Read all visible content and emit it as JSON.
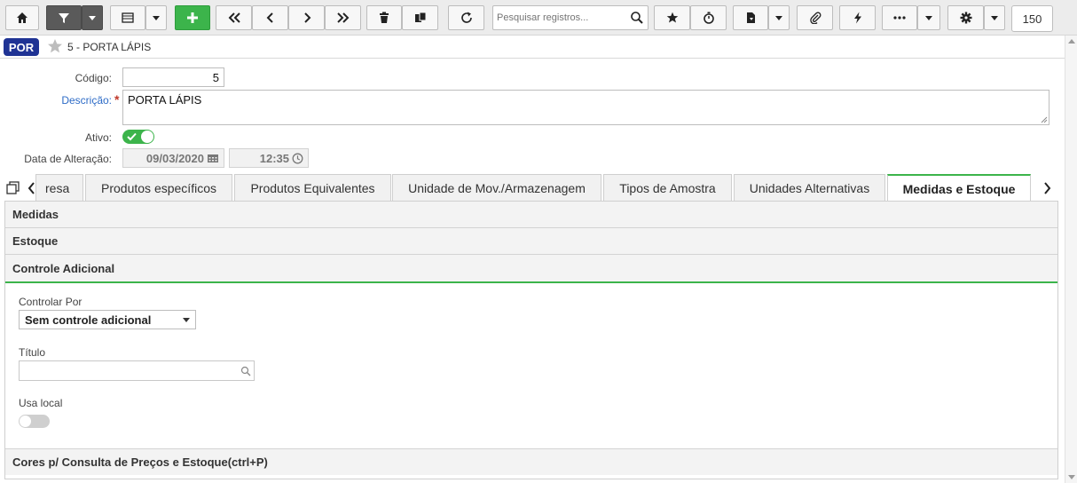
{
  "toolbar": {
    "search_placeholder": "Pesquisar registros...",
    "record_count": "150",
    "icons": [
      "home-icon",
      "filter-icon",
      "list-icon",
      "add-icon",
      "first-icon",
      "prev-icon",
      "next-icon",
      "last-icon",
      "trash-icon",
      "copy-icon",
      "refresh-icon",
      "search-icon",
      "star-icon",
      "timer-icon",
      "report-icon",
      "attach-icon",
      "bolt-icon",
      "more-icon",
      "gear-icon"
    ],
    "accent_color": "#3cb44b"
  },
  "record": {
    "badge": "POR",
    "title": "5 - PORTA LÁPIS"
  },
  "form": {
    "codigo_label": "Código:",
    "codigo_value": "5",
    "descricao_label": "Descrição:",
    "descricao_required": "*",
    "descricao_value": "PORTA LÁPIS",
    "ativo_label": "Ativo:",
    "ativo_value": true,
    "data_alteracao_label": "Data de Alteração:",
    "data_value": "09/03/2020",
    "hora_value": "12:35"
  },
  "tabs": [
    {
      "label": "resa",
      "active": false
    },
    {
      "label": "Produtos específicos",
      "active": false
    },
    {
      "label": "Produtos Equivalentes",
      "active": false
    },
    {
      "label": "Unidade de Mov./Armazenagem",
      "active": false
    },
    {
      "label": "Tipos de Amostra",
      "active": false
    },
    {
      "label": "Unidades Alternativas",
      "active": false
    },
    {
      "label": "Medidas e Estoque",
      "active": true
    }
  ],
  "sections": {
    "medidas": "Medidas",
    "estoque": "Estoque",
    "controle": "Controle Adicional",
    "cores": "Cores p/ Consulta de Preços e Estoque(ctrl+P)"
  },
  "controle": {
    "controlar_por_label": "Controlar Por",
    "controlar_por_value": "Sem controle adicional",
    "titulo_label": "Título",
    "titulo_value": "",
    "usa_local_label": "Usa local",
    "usa_local_value": false
  }
}
